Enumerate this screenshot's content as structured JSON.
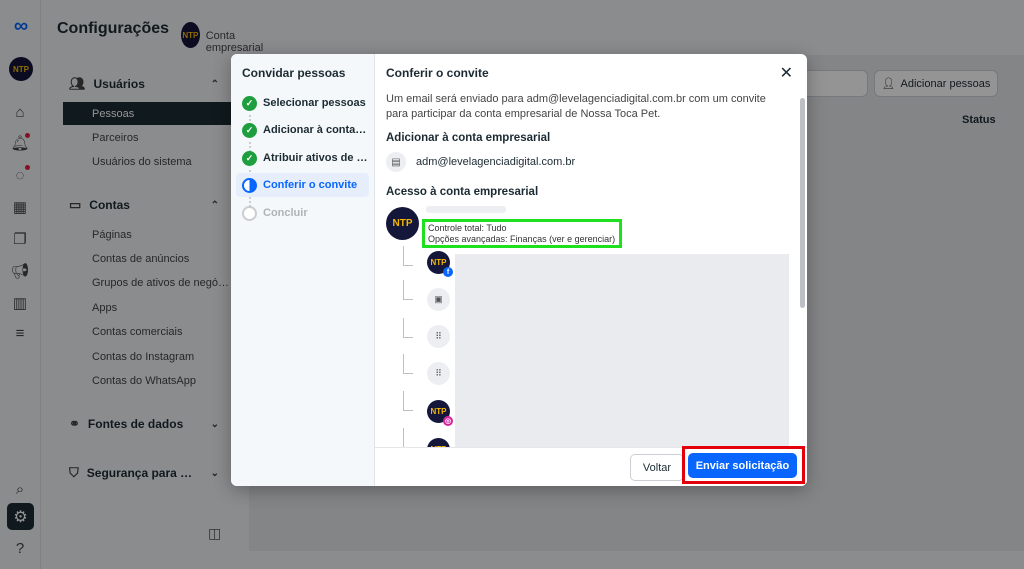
{
  "sidebar": {
    "title": "Configurações",
    "account_name": "Conta empresarial",
    "brand_initials": "NTP",
    "groups": [
      {
        "label": "Usuários",
        "items": [
          "Pessoas",
          "Parceiros",
          "Usuários do sistema"
        ]
      },
      {
        "label": "Contas",
        "items": [
          "Páginas",
          "Contas de anúncios",
          "Grupos de ativos de negó…",
          "Apps",
          "Contas comerciais",
          "Contas do Instagram",
          "Contas do WhatsApp"
        ]
      },
      {
        "label": "Fontes de dados",
        "items": []
      },
      {
        "label": "Segurança para …",
        "items": []
      }
    ],
    "active_item": "Pessoas"
  },
  "main": {
    "add_people_label": "Adicionar pessoas",
    "status_header": "Status"
  },
  "modal": {
    "steps_title": "Convidar pessoas",
    "steps": [
      {
        "label": "Selecionar pessoas",
        "state": "done"
      },
      {
        "label": "Adicionar à conta empresarial",
        "state": "done"
      },
      {
        "label": "Atribuir ativos de negócios",
        "state": "done"
      },
      {
        "label": "Conferir o convite",
        "state": "current"
      },
      {
        "label": "Concluir",
        "state": "pending"
      }
    ],
    "title": "Conferir o convite",
    "description": "Um email será enviado para adm@levelagenciadigital.com.br com um convite para participar da conta empresarial de Nossa Toca Pet.",
    "section_add": "Adicionar à conta empresarial",
    "email": "adm@levelagenciadigital.com.br",
    "section_access": "Acesso à conta empresarial",
    "permissions": {
      "line1": "Controle total: Tudo",
      "line2": "Opções avançadas: Finanças (ver e gerenciar)"
    },
    "back_label": "Voltar",
    "send_label": "Enviar solicitação"
  },
  "colors": {
    "accent": "#0866ff",
    "done": "#1e9e3e",
    "highlight_green": "#1fe01f",
    "highlight_red": "#e3000b"
  }
}
